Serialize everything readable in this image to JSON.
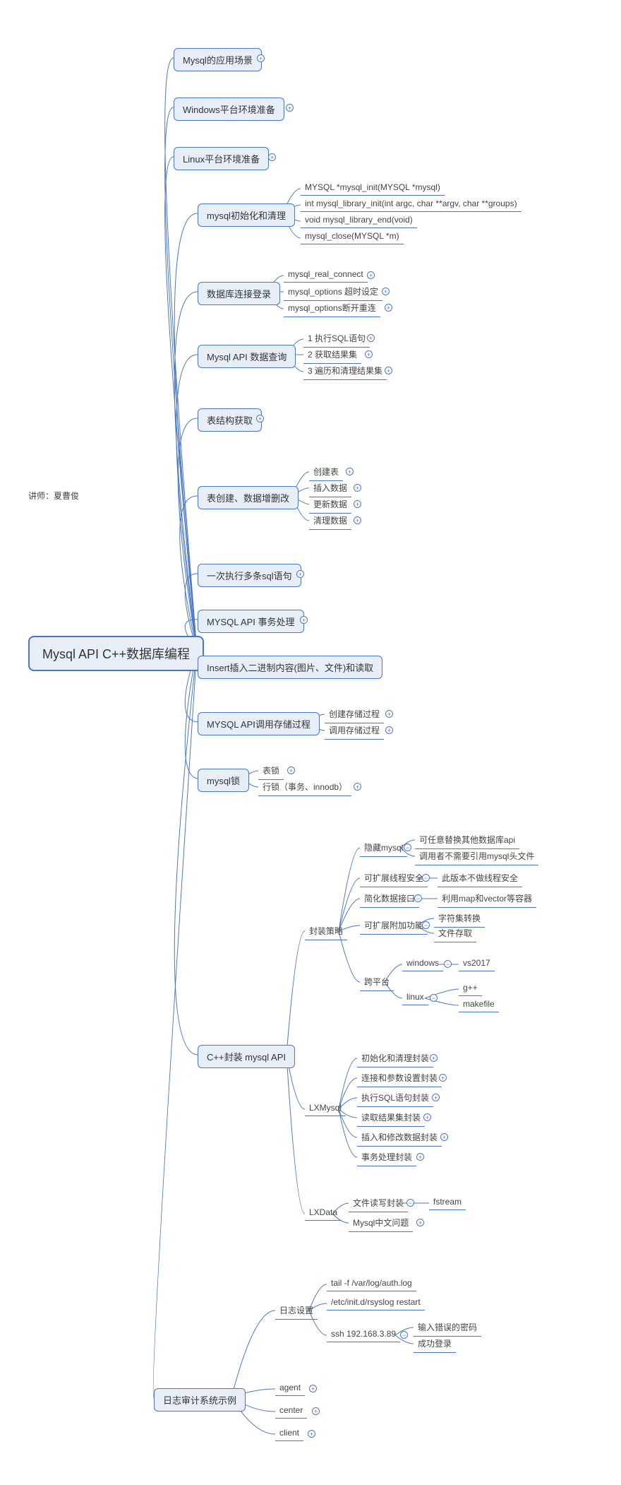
{
  "instructor_label": "讲师：夏曹俊",
  "root": "Mysql API C++数据库编程",
  "b1": "Mysql的应用场景",
  "b2": "Windows平台环境准备",
  "b3": "Linux平台环境准备",
  "b4": "mysql初始化和清理",
  "b4c": [
    "MYSQL *mysql_init(MYSQL *mysql)",
    "int mysql_library_init(int argc, char **argv, char **groups)",
    "void mysql_library_end(void)",
    "mysql_close(MYSQL *m)"
  ],
  "b5": "数据库连接登录",
  "b5c": [
    "mysql_real_connect",
    "mysql_options 超时设定",
    "mysql_options断开重连"
  ],
  "b6": "Mysql API 数据查询",
  "b6c": [
    "1 执行SQL语句",
    "2 获取结果集",
    "3 遍历和清理结果集"
  ],
  "b7": "表结构获取",
  "b8": "表创建、数据增删改",
  "b8c": [
    "创建表",
    "插入数据",
    "更新数据",
    "清理数据"
  ],
  "b9": "一次执行多条sql语句",
  "b10": "MYSQL API 事务处理",
  "b11": "Insert插入二进制内容(图片、文件)和读取",
  "b12": "MYSQL API调用存储过程",
  "b12c": [
    "创建存储过程",
    "调用存储过程"
  ],
  "b13": "mysql锁",
  "b13c": [
    "表锁",
    "行锁（事务、innodb）"
  ],
  "b14": "C++封装 mysql API",
  "s14a": "封装策略",
  "s14a1": "隐藏mysql",
  "s14a1c": [
    "可任意替换其他数据库api",
    "调用者不需要引用mysql头文件"
  ],
  "s14a2": "可扩展线程安全",
  "s14a2c": "此版本不做线程安全",
  "s14a3": "简化数据接口",
  "s14a3c": "利用map和vector等容器",
  "s14a4": "可扩展附加功能",
  "s14a4c": [
    "字符集转换",
    "文件存取"
  ],
  "s14a5": "跨平台",
  "s14a5a": "windows",
  "s14a5ac": "vs2017",
  "s14a5b": "linux",
  "s14a5bc": [
    "g++",
    "makefile"
  ],
  "s14b": "LXMysql",
  "s14bc": [
    "初始化和清理封装",
    "连接和参数设置封装",
    "执行SQL语句封装",
    "读取结果集封装",
    "插入和修改数据封装",
    "事务处理封装"
  ],
  "s14c": "LXData",
  "s14c1": "文件读写封装",
  "s14c1c": "fstream",
  "s14c2": "Mysql中文问题",
  "b15": "日志审计系统示例",
  "s15a": "日志设置",
  "s15ac": [
    "tail -f /var/log/auth.log",
    "/etc/init.d/rsyslog restart"
  ],
  "s15a3": "ssh 192.168.3.89",
  "s15a3c": [
    "输入错误的密码",
    "成功登录"
  ],
  "s15b": "agent",
  "s15c": "center",
  "s15d": "client"
}
